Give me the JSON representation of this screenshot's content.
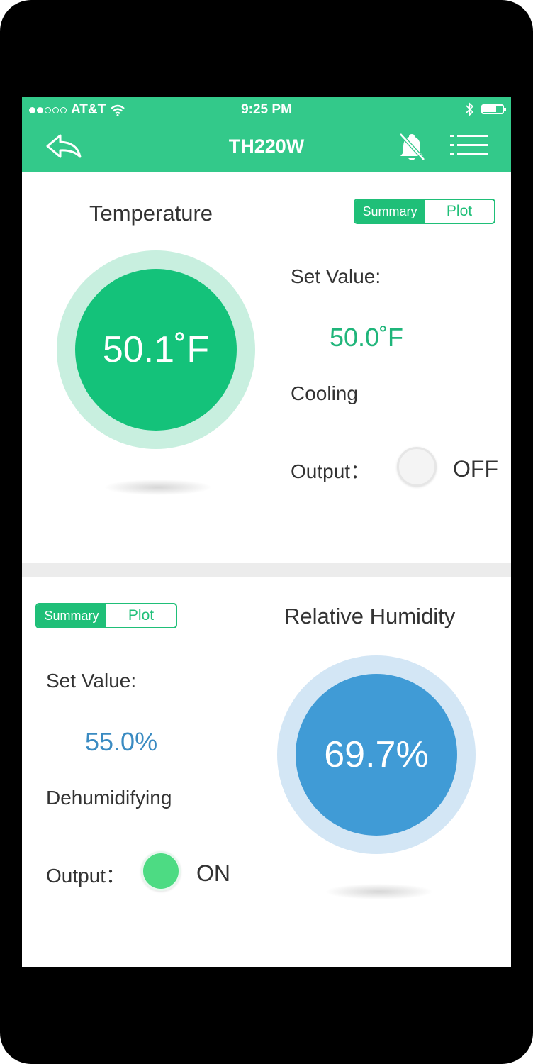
{
  "status_bar": {
    "carrier": "AT&T",
    "time": "9:25 PM",
    "signal_dots_filled": 2,
    "signal_dots_total": 5
  },
  "header": {
    "title": "TH220W",
    "icons": [
      "back-icon",
      "bell-off-icon",
      "menu-icon"
    ],
    "background": "#33c98a"
  },
  "temperature": {
    "heading": "Temperature",
    "toggle": {
      "summary": "Summary",
      "plot": "Plot",
      "selected": "Summary"
    },
    "reading": "50.1˚F",
    "set_value_label": "Set Value:",
    "set_value": "50.0˚F",
    "mode": "Cooling",
    "output_label": "Output：",
    "output_state": "OFF",
    "colors": {
      "ring": "#c8efdf",
      "fill": "#14c27a",
      "value_text": "#1fb57a"
    }
  },
  "humidity": {
    "heading": "Relative Humidity",
    "toggle": {
      "summary": "Summary",
      "plot": "Plot",
      "selected": "Summary"
    },
    "reading": "69.7%",
    "set_value_label": "Set Value:",
    "set_value": "55.0%",
    "mode": "Dehumidifying",
    "output_label": "Output：",
    "output_state": "ON",
    "colors": {
      "ring": "#d3e6f5",
      "fill": "#409bd6",
      "value_text": "#3a8bc2"
    }
  }
}
